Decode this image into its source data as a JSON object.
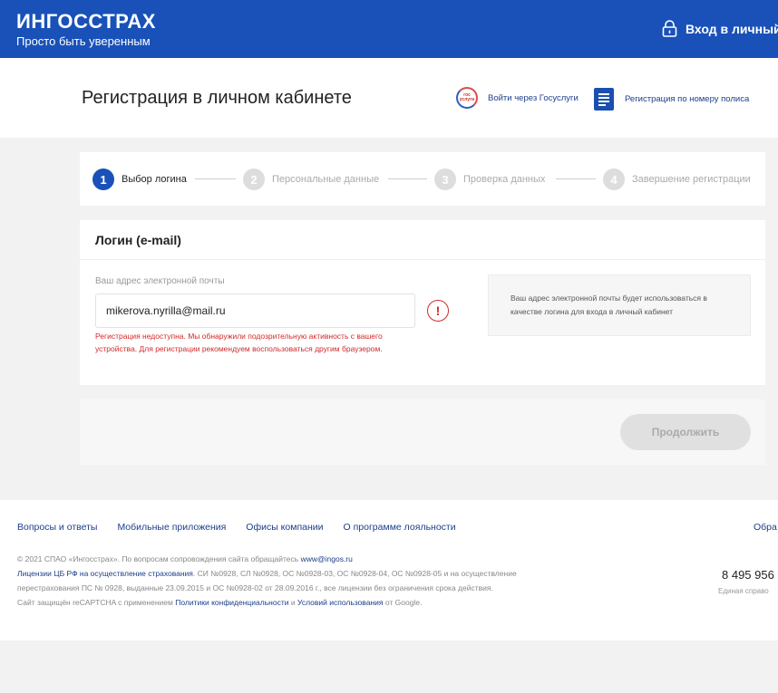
{
  "colors": {
    "brand_blue": "#1951b8",
    "error_red": "#d02a2a"
  },
  "header": {
    "brand_name": "ИНГОССТРАХ",
    "brand_tagline": "Просто быть уверенным",
    "login_label": "Вход в личный",
    "login_icon": "lock-icon"
  },
  "page": {
    "title": "Регистрация в личном кабинете",
    "gosuslugi_link": "Войти через Госуслуги",
    "gosuslugi_icon_text": "гос услуги",
    "policy_link": "Регистрация по номеру полиса"
  },
  "steps": [
    {
      "num": "1",
      "label": "Выбор логина"
    },
    {
      "num": "2",
      "label": "Персональные данные"
    },
    {
      "num": "3",
      "label": "Проверка данных"
    },
    {
      "num": "4",
      "label": "Завершение регистрации"
    }
  ],
  "form": {
    "heading": "Логин (e-mail)",
    "email_label": "Ваш адрес электронной почты",
    "email_value": "mikerova.nyrilla@mail.ru",
    "error_icon": "!",
    "error_message": "Регистрация недоступна. Мы обнаружили подозрительную активность с вашего устройства. Для регистрации рекомендуем воспользоваться другим браузером.",
    "hint": "Ваш адрес электронной почты будет использоваться в качестве логина для входа в личный кабинет"
  },
  "actions": {
    "continue_label": "Продолжить"
  },
  "footer": {
    "nav": [
      "Вопросы и ответы",
      "Мобильные приложения",
      "Офисы компании",
      "О программе лояльности"
    ],
    "nav_cut": "Обра",
    "copyright": "© 2021 СПАО «Ингосстрах». По вопросам сопровождения сайта обращайтесь",
    "support_email": "www@ingos.ru",
    "licenses_link": "Лицензии ЦБ РФ на осуществление страхования",
    "licenses_text": ". СИ №0928, СЛ №0928, ОС №0928-03, ОС №0928-04, ОС №0928-05 и на осуществление перестрахования ПС № 0928, выданные 23.09.2015 и ОС №0928-02 от 28.09.2016 г., все лицензии без ограничения срока действия.",
    "recaptcha_prefix": "Сайт защищён reCAPTCHA с применением",
    "privacy_link": "Политики конфиденциальности",
    "and": "и",
    "terms_link": "Условий использования",
    "recaptcha_suffix": "от Google.",
    "phone": "8 495 956",
    "phone_note": "Единая справо"
  }
}
